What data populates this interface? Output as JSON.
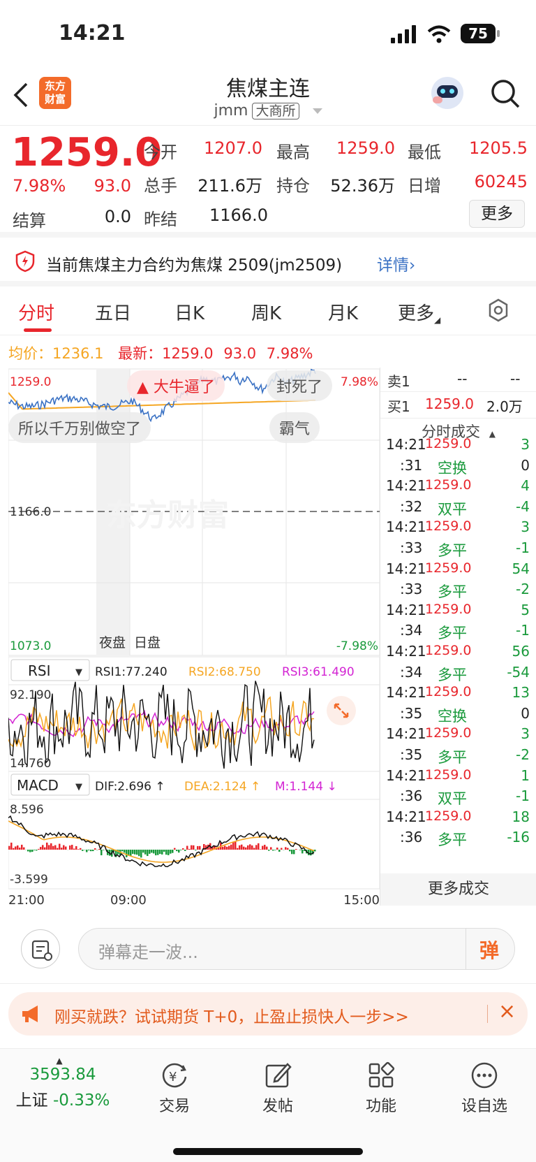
{
  "status": {
    "time": "14:21",
    "battery": "75"
  },
  "header": {
    "title": "焦煤主连",
    "code": "jmm",
    "exchange": "大商所",
    "logo_text_1": "东方",
    "logo_text_2": "财富"
  },
  "quote": {
    "price": "1259.0",
    "change_pct": "7.98%",
    "change": "93.0",
    "labels": {
      "open": "今开",
      "high": "最高",
      "low": "最低",
      "volume": "总手",
      "oi": "持仓",
      "day_inc": "日增",
      "settle": "结算",
      "prev_settle": "昨结"
    },
    "open": "1207.0",
    "high": "1259.0",
    "low": "1205.5",
    "volume": "211.6万",
    "oi": "52.36万",
    "day_inc": "60245",
    "settle": "0.0",
    "prev_settle": "1166.0",
    "more_button": "更多"
  },
  "notice": {
    "text": "当前焦煤主力合约为焦煤 2509(jm2509)",
    "link": "详情"
  },
  "tabs": [
    {
      "label": "分时"
    },
    {
      "label": "五日"
    },
    {
      "label": "日K"
    },
    {
      "label": "周K"
    },
    {
      "label": "月K"
    },
    {
      "label": "更多"
    }
  ],
  "info_line": {
    "avg_label": "均价：",
    "avg": "1236.1",
    "latest_label": "最新：",
    "latest": "1259.0",
    "change": "93.0",
    "pct": "7.98%"
  },
  "chart": {
    "top_price": "1259.0",
    "top_pct": "7.98%",
    "mid_price": "1166.0",
    "bottom_price": "1073.0",
    "bottom_pct": "-7.98%",
    "night_label": "夜盘",
    "day_label": "日盘",
    "watermark": "东方财富",
    "danmaku": [
      "大牛逼了",
      "封死了",
      "所以千万别做空了",
      "霸气"
    ],
    "rsi_select": "RSI",
    "rsi1": "RSI1:77.240",
    "rsi2": "RSI2:68.750",
    "rsi3": "RSI3:61.490",
    "rsi_top": "92.190",
    "rsi_bottom": "14.760",
    "macd_select": "MACD",
    "dif": "DIF:2.696 ↑",
    "dea": "DEA:2.124 ↑",
    "m": "M:1.144 ↓",
    "macd_top": "8.596",
    "macd_bottom": "-3.599",
    "time_start": "21:00",
    "time_mid": "09:00",
    "time_end": "15:00"
  },
  "orderbook": {
    "sell_label": "卖1",
    "sell_price": "--",
    "sell_vol": "--",
    "buy_label": "买1",
    "buy_price": "1259.0",
    "buy_vol": "2.0万"
  },
  "trades_title": "分时成交",
  "trades": [
    {
      "t": "14:21",
      "v": "1259.0",
      "n": "3"
    },
    {
      "t": ":31",
      "v": "空换",
      "n": "0"
    },
    {
      "t": "14:21",
      "v": "1259.0",
      "n": "4"
    },
    {
      "t": ":32",
      "v": "双平",
      "n": "-4"
    },
    {
      "t": "14:21",
      "v": "1259.0",
      "n": "3"
    },
    {
      "t": ":33",
      "v": "多平",
      "n": "-1"
    },
    {
      "t": "14:21",
      "v": "1259.0",
      "n": "54"
    },
    {
      "t": ":33",
      "v": "多平",
      "n": "-2"
    },
    {
      "t": "14:21",
      "v": "1259.0",
      "n": "5"
    },
    {
      "t": ":34",
      "v": "多平",
      "n": "-1"
    },
    {
      "t": "14:21",
      "v": "1259.0",
      "n": "56"
    },
    {
      "t": ":34",
      "v": "多平",
      "n": "-54"
    },
    {
      "t": "14:21",
      "v": "1259.0",
      "n": "13"
    },
    {
      "t": ":35",
      "v": "空换",
      "n": "0"
    },
    {
      "t": "14:21",
      "v": "1259.0",
      "n": "3"
    },
    {
      "t": ":35",
      "v": "多平",
      "n": "-2"
    },
    {
      "t": "14:21",
      "v": "1259.0",
      "n": "1"
    },
    {
      "t": ":36",
      "v": "双平",
      "n": "-1"
    },
    {
      "t": "14:21",
      "v": "1259.0",
      "n": "18"
    },
    {
      "t": ":36",
      "v": "多平",
      "n": "-16"
    }
  ],
  "more_trades": "更多成交",
  "comment": {
    "placeholder": "弹幕走一波...",
    "danmaku_btn": "弹"
  },
  "promo": {
    "text": "刚买就跌？试试期货 T+0，止盈止损快人一步>>"
  },
  "bottom_nav": {
    "index_value": "3593.84",
    "index_name": "上证",
    "index_change": "-0.33%",
    "items": [
      {
        "label": "交易"
      },
      {
        "label": "发帖"
      },
      {
        "label": "功能"
      },
      {
        "label": "设自选"
      }
    ]
  },
  "colors": {
    "up": "#e8262c",
    "down": "#1a9a3c",
    "avg": "#f5a623",
    "price": "#3b72c4"
  }
}
